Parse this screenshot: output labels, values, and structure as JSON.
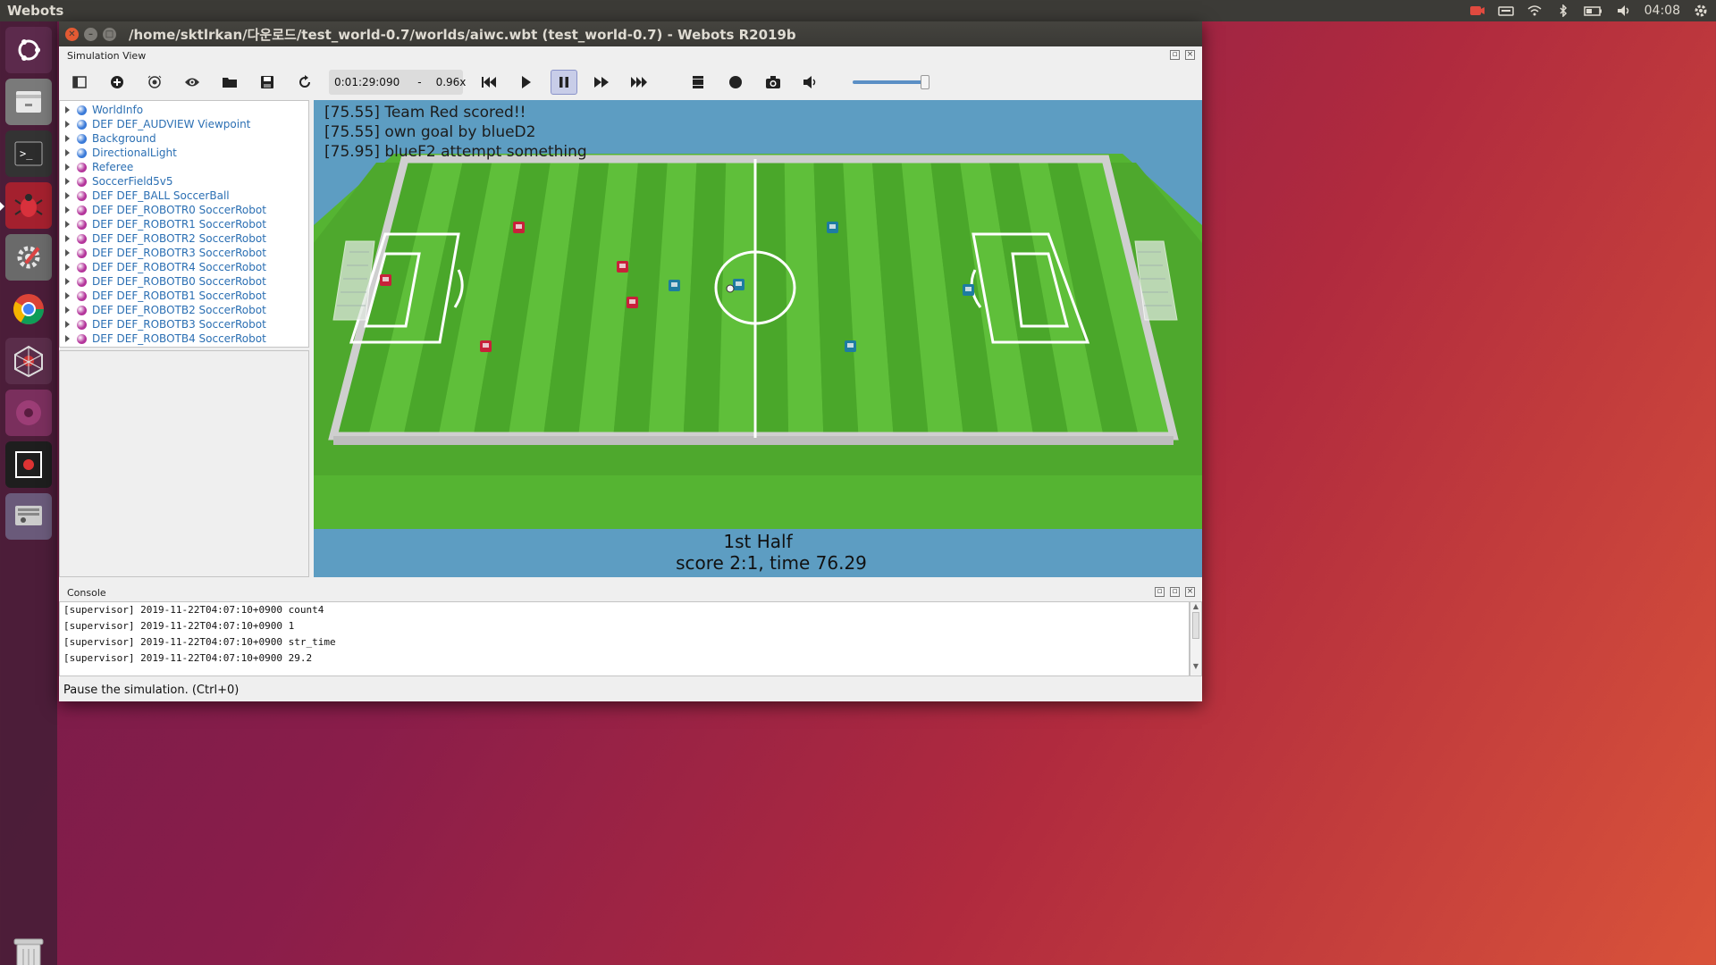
{
  "topbar": {
    "app_title": "Webots",
    "clock": "04:08"
  },
  "launcher": {
    "items": [
      "ubuntu-logo-icon",
      "files-icon",
      "terminal-icon",
      "bug-icon",
      "settings-icon",
      "chrome-icon",
      "webots-icon",
      "music-icon",
      "screenshot-icon",
      "display-icon"
    ],
    "trash": "trash-icon"
  },
  "window": {
    "title": "/home/sktlrkan/다운로드/test_world-0.7/worlds/aiwc.wbt (test_world-0.7) - Webots R2019b",
    "sim_view_label": "Simulation View",
    "toolbar": {
      "time": "0:01:29:090",
      "separator": "-",
      "speed": "0.96x"
    },
    "scene_tree": [
      {
        "label": "WorldInfo",
        "color": "#3a7ad8"
      },
      {
        "label": "DEF DEF_AUDVIEW Viewpoint",
        "color": "#3a7ad8"
      },
      {
        "label": "Background",
        "color": "#3a7ad8"
      },
      {
        "label": "DirectionalLight",
        "color": "#3a7ad8"
      },
      {
        "label": "Referee",
        "color": "#b4359b"
      },
      {
        "label": "SoccerField5v5",
        "color": "#b4359b"
      },
      {
        "label": "DEF DEF_BALL SoccerBall",
        "color": "#b4359b"
      },
      {
        "label": "DEF DEF_ROBOTR0 SoccerRobot",
        "color": "#b4359b"
      },
      {
        "label": "DEF DEF_ROBOTR1 SoccerRobot",
        "color": "#b4359b"
      },
      {
        "label": "DEF DEF_ROBOTR2 SoccerRobot",
        "color": "#b4359b"
      },
      {
        "label": "DEF DEF_ROBOTR3 SoccerRobot",
        "color": "#b4359b"
      },
      {
        "label": "DEF DEF_ROBOTR4 SoccerRobot",
        "color": "#b4359b"
      },
      {
        "label": "DEF DEF_ROBOTB0 SoccerRobot",
        "color": "#b4359b"
      },
      {
        "label": "DEF DEF_ROBOTB1 SoccerRobot",
        "color": "#b4359b"
      },
      {
        "label": "DEF DEF_ROBOTB2 SoccerRobot",
        "color": "#b4359b"
      },
      {
        "label": "DEF DEF_ROBOTB3 SoccerRobot",
        "color": "#b4359b"
      },
      {
        "label": "DEF DEF_ROBOTB4 SoccerRobot",
        "color": "#b4359b"
      }
    ],
    "view3d": {
      "messages": [
        "[75.55] Team Red scored!!",
        "[75.55] own goal by blueD2",
        "[75.95] blueF2 attempt something"
      ],
      "half": "1st Half",
      "score_line": "score 2:1, time 76.29"
    },
    "console": {
      "title": "Console",
      "lines": [
        "[supervisor] 2019-11-22T04:07:10+0900 count4",
        "[supervisor] 2019-11-22T04:07:10+0900 1",
        "[supervisor] 2019-11-22T04:07:10+0900 str_time",
        "[supervisor] 2019-11-22T04:07:10+0900 29.2"
      ]
    },
    "status": "Pause the simulation. (Ctrl+0)"
  },
  "colors": {
    "team_red": "#c8213a",
    "team_blue": "#1d7ca1",
    "field_light": "#5fbf3a",
    "field_dark": "#4aa72a",
    "sky": "#5d9dc2"
  }
}
